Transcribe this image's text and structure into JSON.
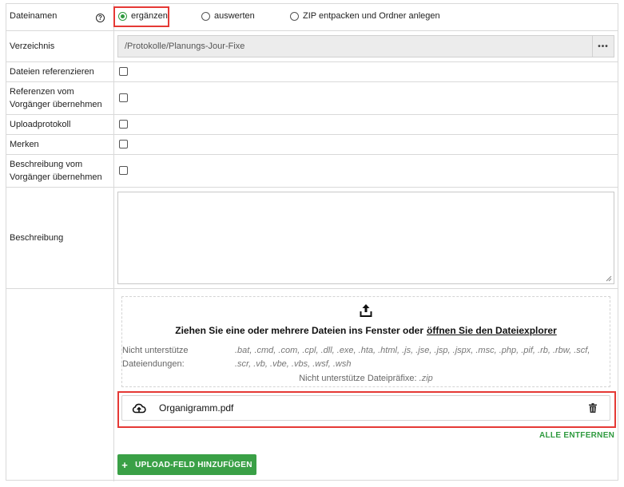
{
  "fields": {
    "dateinamen": {
      "label": "Dateinamen",
      "help_icon": "?",
      "options": [
        "ergänzen",
        "auswerten",
        "ZIP entpacken und Ordner anlegen"
      ],
      "selected": "ergänzen"
    },
    "verzeichnis": {
      "label": "Verzeichnis",
      "value": "/Protokolle/Planungs-Jour-Fixe",
      "button": "•••"
    },
    "dateien_referenzieren": {
      "label": "Dateien referenzieren",
      "checked": false
    },
    "referenzen_vorgaenger": {
      "label": "Referenzen vom Vorgänger übernehmen",
      "checked": false
    },
    "uploadprotokoll": {
      "label": "Uploadprotokoll",
      "checked": false
    },
    "merken": {
      "label": "Merken",
      "checked": false
    },
    "beschreibung_vorgaenger": {
      "label": "Beschreibung vom Vorgänger übernehmen",
      "checked": false
    },
    "beschreibung": {
      "label": "Beschreibung",
      "value": ""
    }
  },
  "upload": {
    "dropzone": {
      "title": "Ziehen Sie eine oder mehrere Dateien ins Fenster oder",
      "link": "öffnen Sie den Dateiexplorer",
      "unsupported_label": "Nicht unterstütze Dateiendungen:",
      "unsupported_extensions": ".bat, .cmd, .com, .cpl, .dll, .exe, .hta, .html, .js, .jse, .jsp, .jspx, .msc, .php, .pif, .rb, .rbw, .scf, .scr, .vb, .vbe, .vbs, .wsf, .wsh",
      "prefix_label": "Nicht unterstütze Dateipräfixe:",
      "prefix_value": ".zip"
    },
    "files": [
      {
        "name": "Organigramm.pdf"
      }
    ],
    "remove_all": "ALLE ENTFERNEN",
    "add_field": "UPLOAD-FELD HINZUFÜGEN"
  },
  "colors": {
    "accent": "#3aa046",
    "highlight": "#e53935",
    "border": "#d9d9d9"
  },
  "icons": [
    "help-icon",
    "more-icon",
    "upload-icon",
    "cloud-upload-icon",
    "trash-icon",
    "plus-icon",
    "resize-grip-icon"
  ]
}
